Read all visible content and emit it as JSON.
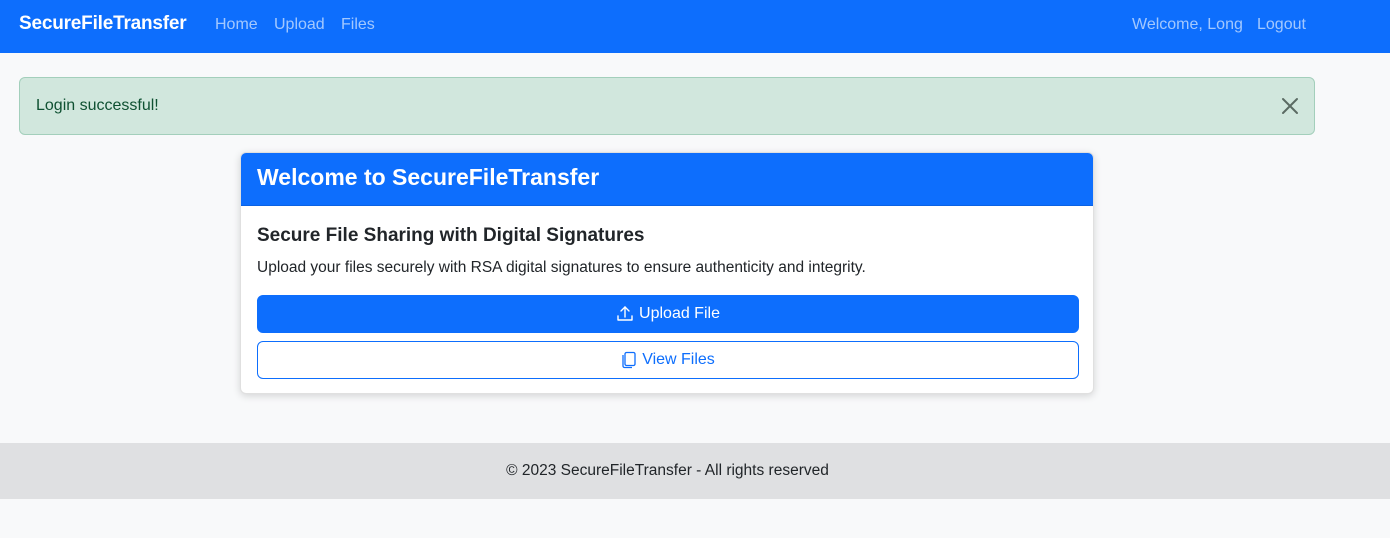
{
  "navbar": {
    "brand": "SecureFileTransfer",
    "links": [
      "Home",
      "Upload",
      "Files"
    ],
    "welcome": "Welcome, Long",
    "logout": "Logout"
  },
  "alert": {
    "message": "Login successful!",
    "close_icon": "close-icon"
  },
  "card": {
    "title": "Welcome to SecureFileTransfer",
    "subtitle": "Secure File Sharing with Digital Signatures",
    "description": "Upload your files securely with RSA digital signatures to ensure authenticity and integrity.",
    "upload_button": "Upload File",
    "upload_icon": "upload-icon",
    "view_button": "View Files",
    "view_icon": "files-icon"
  },
  "footer": {
    "text": "© 2023 SecureFileTransfer - All rights reserved"
  },
  "colors": {
    "primary": "#0d6efd",
    "alert_bg": "#d1e7dd",
    "footer_bg": "#dfe0e2",
    "page_bg": "#f8f9fa"
  }
}
